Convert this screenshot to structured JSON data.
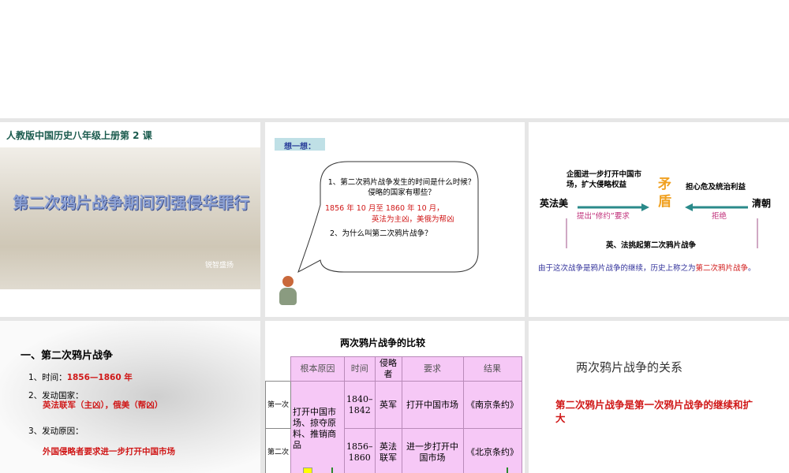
{
  "slide1": {
    "header": "人教版中国历史八年级上册第 2 课",
    "title": "第二次鸦片战争期间列强侵华罪行",
    "logo_text": "锐智盛扬"
  },
  "slide2": {
    "tag": "想一想：",
    "q1": "1、第二次鸦片战争发生的时间是什么时候？ 侵略的国家有哪些？",
    "a1_line1": "1856 年 10 月至 1860 年 10 月，",
    "a1_line2": "英法为主凶，美俄为帮凶",
    "q2": "2、为什么叫第二次鸦片战争？"
  },
  "slide3": {
    "left_party": "英法美",
    "right_party": "清朝",
    "left_goal": "企图进一步打开中国市场，扩大侵略权益",
    "right_goal": "担心危及统治利益",
    "center": "矛盾",
    "left_action": "提出“修约”要求",
    "right_action": "拒绝",
    "result": "英、法挑起第二次鸦片战争",
    "conclusion_prefix": "由于这次战争是鸦片战争的继续，历史上称之为",
    "conclusion_highlight": "第二次鸦片战争",
    "conclusion_suffix": "。"
  },
  "slide4": {
    "heading": "一、第二次鸦片战争",
    "item1_label": "1、时间：",
    "item1_value": "1856—1860 年",
    "item2_label": "2、发动国家：",
    "item2_value": "英法联军（主凶），俄美（帮凶）",
    "item3_label": "3、发动原因：",
    "item3_value": "外国侵略者要求进一步打开中国市场"
  },
  "slide5": {
    "title": "两次鸦片战争的比较",
    "headers": [
      "根本原因",
      "时间",
      "侵略者",
      "要求",
      "结果"
    ],
    "rows": [
      {
        "label": "第一次",
        "time": "1840–1842",
        "aggressor": "英军",
        "demand": "打开中国市场",
        "result": "《南京条约》"
      },
      {
        "label": "第二次",
        "time": "1856–1860",
        "aggressor": "英法联军",
        "demand": "进一步打开中国市场",
        "result": "《北京条约》"
      }
    ],
    "root_cause": "打开中国市场、掠夺原料、推销商品"
  },
  "slide6": {
    "title": "两次鸦片战争的关系",
    "statement": "第二次鸦片战争是第一次鸦片战争的继续和扩大"
  }
}
